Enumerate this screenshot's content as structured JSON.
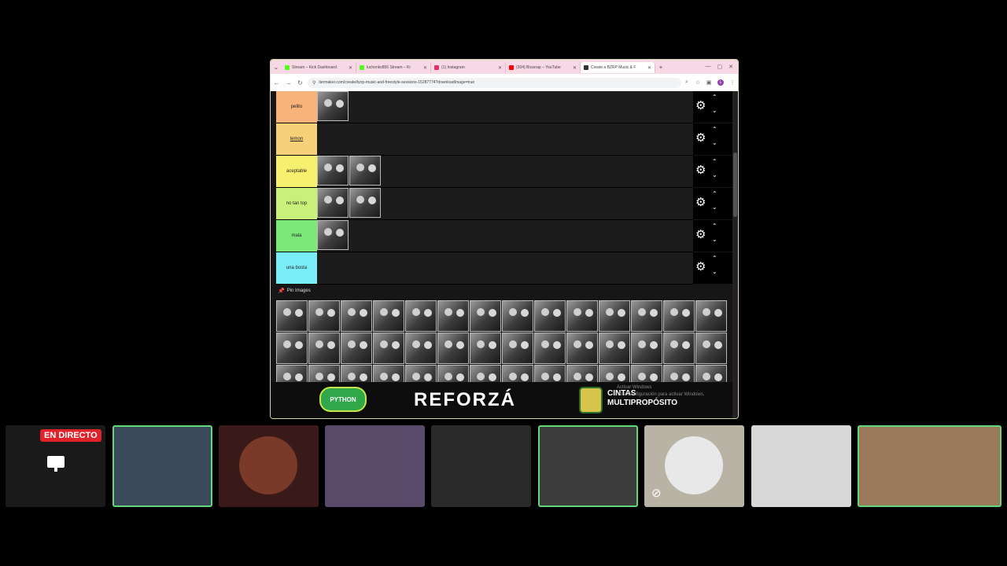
{
  "browser": {
    "tabs": [
      {
        "label": "Stream – Kick Dashboard",
        "fav_color": "#53fc18",
        "active": false
      },
      {
        "label": "luchonks856 Stream – Ki",
        "fav_color": "#53fc18",
        "active": false
      },
      {
        "label": "(1) Instagram",
        "fav_color": "#e1306c",
        "active": false
      },
      {
        "label": "(304) Bizarrap – YouTube",
        "fav_color": "#ff0000",
        "active": false
      },
      {
        "label": "Create a BZRP Music & F",
        "fav_color": "#333333",
        "active": true
      }
    ],
    "url": "tiermaker.com/create/bzrp-music-and-freestyle-sessions-15287774?downloadImage=true"
  },
  "tiers": [
    {
      "label": "pelito",
      "color": "#f7b37a",
      "image_count": 1
    },
    {
      "label": "lemon",
      "color": "#f7d07a",
      "image_count": 0
    },
    {
      "label": "aceptable",
      "color": "#f7f06e",
      "image_count": 2
    },
    {
      "label": "no tan top",
      "color": "#c8f07a",
      "image_count": 2
    },
    {
      "label": "mala",
      "color": "#7ce87a",
      "image_count": 1
    },
    {
      "label": "una bosta",
      "color": "#7aeef7",
      "image_count": 0
    }
  ],
  "pin_images_label": "Pin Images",
  "pool_image_count": 42,
  "ad": {
    "left_logo_text": "PYTHON",
    "headline": "REFORZÁ",
    "right_line1": "CINTAS",
    "right_line2": "MULTIPROPÓSITO"
  },
  "windows_watermark": {
    "line1": "Activar Windows",
    "line2": "Ve a Configuración para activar Windows."
  },
  "live_badge": "EN DIRECTO",
  "participants": [
    {
      "bg": "#1a1a1a",
      "active": false
    },
    {
      "bg": "#3a4a5a",
      "active": true
    },
    {
      "bg": "#3a1a18",
      "active": false
    },
    {
      "bg": "#5a4a6a",
      "active": false
    },
    {
      "bg": "#2a2a2a",
      "active": false
    },
    {
      "bg": "#3c3c3c",
      "active": true
    },
    {
      "bg": "#b9b3a6",
      "active": false
    },
    {
      "bg": "#d8d8d8",
      "active": false
    },
    {
      "bg": "#9a7a5a",
      "active": true
    }
  ]
}
